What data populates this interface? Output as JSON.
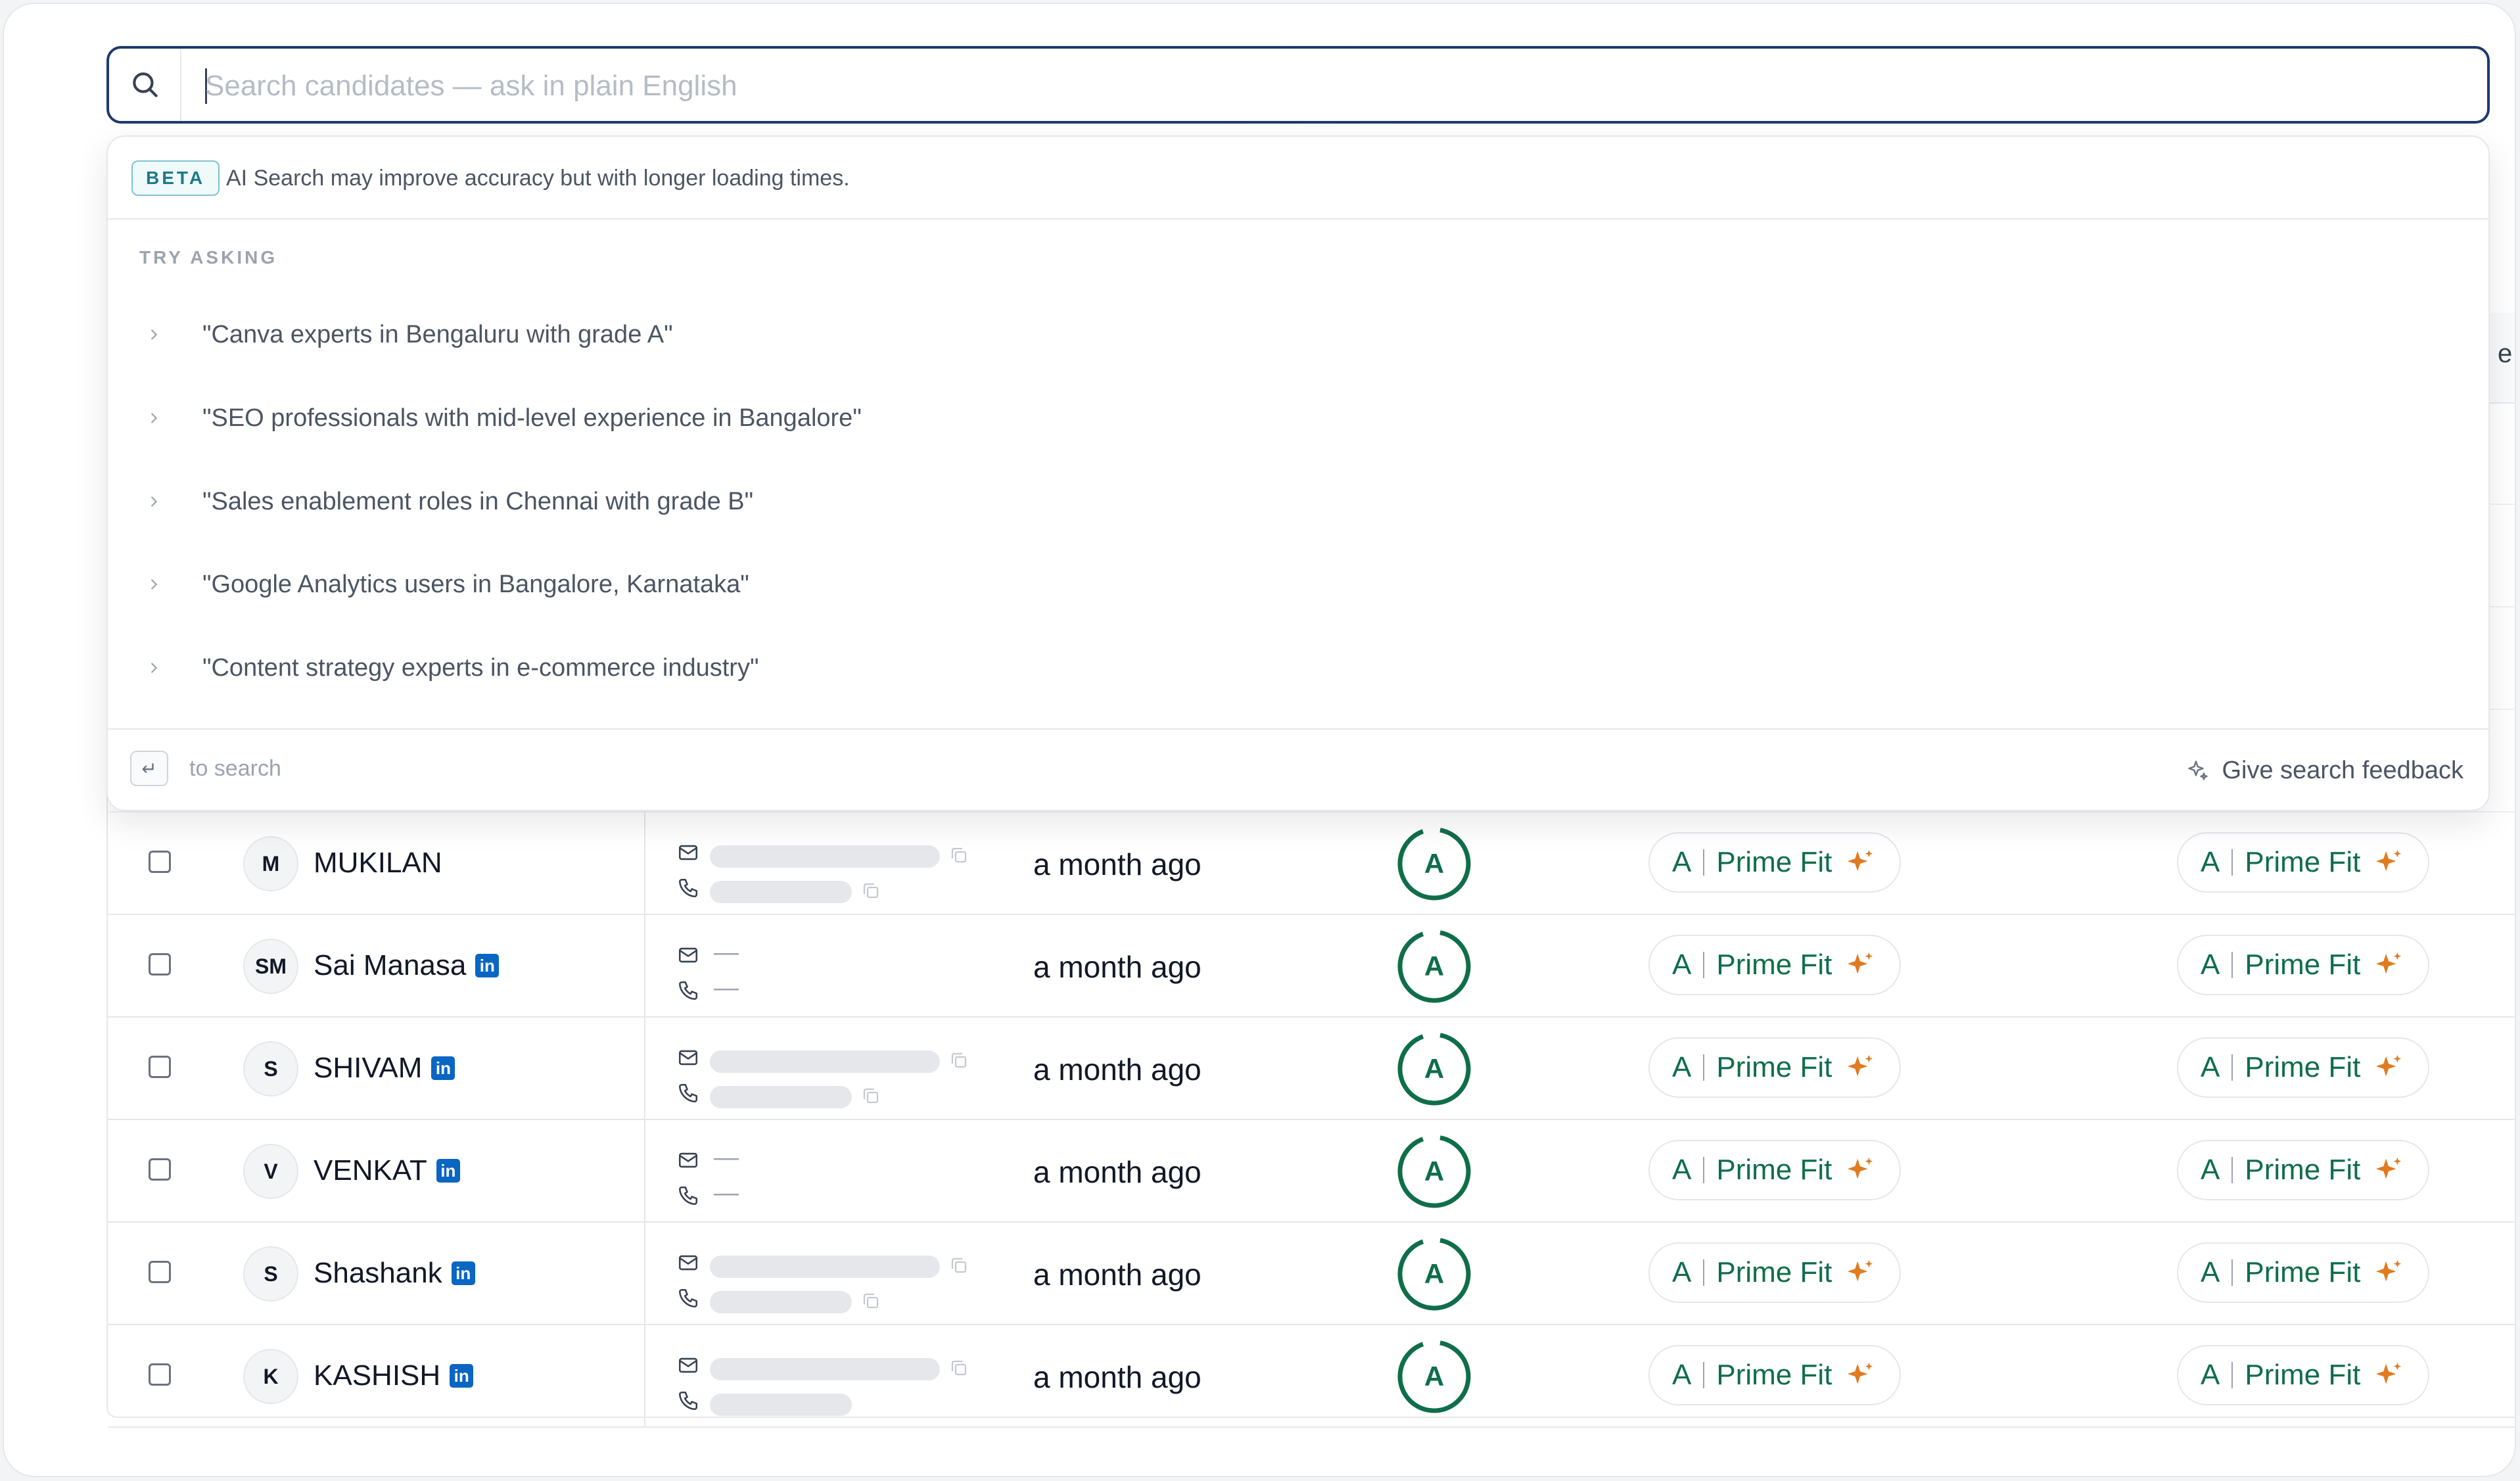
{
  "search": {
    "placeholder": "Search candidates — ask in plain English",
    "value": ""
  },
  "dropdown": {
    "beta_label": "BETA",
    "beta_text": "AI Search may improve accuracy but with longer loading times.",
    "try_heading": "TRY ASKING",
    "suggestions": [
      "\"Canva experts in Bengaluru with grade A\"",
      "\"SEO professionals with mid-level experience in Bangalore\"",
      "\"Sales enablement roles in Chennai with grade B\"",
      "\"Google Analytics users in Bangalore, Karnataka\"",
      "\"Content strategy experts in e-commerce industry\""
    ],
    "enter_key": "↵",
    "footer_hint": "to search",
    "feedback_label": "Give search feedback"
  },
  "table": {
    "header_stub": "e",
    "rows": [
      {
        "initials": "M",
        "name": "MUKILAN",
        "linkedin": false,
        "email": "",
        "phone": "",
        "email_empty": false,
        "phone_empty": false,
        "updated": "a month ago",
        "grade": "A",
        "fit1_grade": "A",
        "fit1_label": "Prime Fit",
        "fit2_grade": "A",
        "fit2_label": "Prime Fit"
      },
      {
        "initials": "SM",
        "name": "Sai Manasa",
        "linkedin": true,
        "email": "—",
        "phone": "—",
        "email_empty": true,
        "phone_empty": true,
        "updated": "a month ago",
        "grade": "A",
        "fit1_grade": "A",
        "fit1_label": "Prime Fit",
        "fit2_grade": "A",
        "fit2_label": "Prime Fit"
      },
      {
        "initials": "S",
        "name": "SHIVAM",
        "linkedin": true,
        "email": "",
        "phone": "",
        "email_empty": false,
        "phone_empty": false,
        "updated": "a month ago",
        "grade": "A",
        "fit1_grade": "A",
        "fit1_label": "Prime Fit",
        "fit2_grade": "A",
        "fit2_label": "Prime Fit"
      },
      {
        "initials": "V",
        "name": "VENKAT",
        "linkedin": true,
        "email": "—",
        "phone": "—",
        "email_empty": true,
        "phone_empty": true,
        "updated": "a month ago",
        "grade": "A",
        "fit1_grade": "A",
        "fit1_label": "Prime Fit",
        "fit2_grade": "A",
        "fit2_label": "Prime Fit"
      },
      {
        "initials": "S",
        "name": "Shashank",
        "linkedin": true,
        "email": "",
        "phone": "",
        "email_empty": false,
        "phone_empty": false,
        "updated": "a month ago",
        "grade": "A",
        "fit1_grade": "A",
        "fit1_label": "Prime Fit",
        "fit2_grade": "A",
        "fit2_label": "Prime Fit"
      },
      {
        "initials": "K",
        "name": "KASHISH",
        "linkedin": true,
        "email": "",
        "phone": "",
        "email_empty": false,
        "phone_empty": false,
        "updated": "a month ago",
        "grade": "A",
        "fit1_grade": "A",
        "fit1_label": "Prime Fit",
        "fit2_grade": "A",
        "fit2_label": "Prime Fit"
      }
    ],
    "linkedin_badge": "in"
  },
  "colors": {
    "search_border": "#1e3a6e",
    "grade_green": "#0f6e4a",
    "sparkle_orange": "#e07b1f",
    "beta_teal": "#1c7a8a",
    "linkedin_blue": "#0a66c2"
  },
  "icons": {
    "search": "search-icon",
    "chevron": "chevron-right-icon",
    "email": "mail-icon",
    "phone": "phone-icon",
    "copy": "copy-icon",
    "sparkle": "sparkle-icon",
    "feedback": "sparkles-outline-icon",
    "linkedin": "linkedin-icon",
    "enter": "enter-key-icon"
  }
}
